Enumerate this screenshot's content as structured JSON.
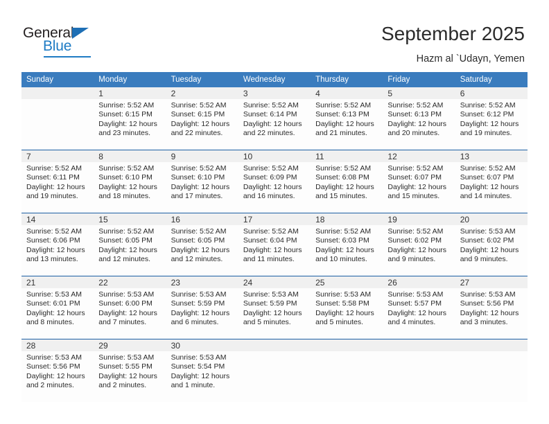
{
  "brand": {
    "name_general": "General",
    "name_blue": "Blue"
  },
  "header": {
    "title": "September 2025",
    "subtitle": "Hazm al `Udayn, Yemen"
  },
  "colors": {
    "header_blue": "#3a7cbe",
    "row_rule_blue": "#1b5fa4",
    "daynum_band": "#f0f0f0",
    "logo_blue": "#1e7bc4"
  },
  "calendar": {
    "weekdays": [
      "Sunday",
      "Monday",
      "Tuesday",
      "Wednesday",
      "Thursday",
      "Friday",
      "Saturday"
    ],
    "weeks": [
      [
        {
          "day": "",
          "empty": true
        },
        {
          "day": "1",
          "sunrise": "Sunrise: 5:52 AM",
          "sunset": "Sunset: 6:15 PM",
          "daylight": "Daylight: 12 hours and 23 minutes."
        },
        {
          "day": "2",
          "sunrise": "Sunrise: 5:52 AM",
          "sunset": "Sunset: 6:15 PM",
          "daylight": "Daylight: 12 hours and 22 minutes."
        },
        {
          "day": "3",
          "sunrise": "Sunrise: 5:52 AM",
          "sunset": "Sunset: 6:14 PM",
          "daylight": "Daylight: 12 hours and 22 minutes."
        },
        {
          "day": "4",
          "sunrise": "Sunrise: 5:52 AM",
          "sunset": "Sunset: 6:13 PM",
          "daylight": "Daylight: 12 hours and 21 minutes."
        },
        {
          "day": "5",
          "sunrise": "Sunrise: 5:52 AM",
          "sunset": "Sunset: 6:13 PM",
          "daylight": "Daylight: 12 hours and 20 minutes."
        },
        {
          "day": "6",
          "sunrise": "Sunrise: 5:52 AM",
          "sunset": "Sunset: 6:12 PM",
          "daylight": "Daylight: 12 hours and 19 minutes."
        }
      ],
      [
        {
          "day": "7",
          "sunrise": "Sunrise: 5:52 AM",
          "sunset": "Sunset: 6:11 PM",
          "daylight": "Daylight: 12 hours and 19 minutes."
        },
        {
          "day": "8",
          "sunrise": "Sunrise: 5:52 AM",
          "sunset": "Sunset: 6:10 PM",
          "daylight": "Daylight: 12 hours and 18 minutes."
        },
        {
          "day": "9",
          "sunrise": "Sunrise: 5:52 AM",
          "sunset": "Sunset: 6:10 PM",
          "daylight": "Daylight: 12 hours and 17 minutes."
        },
        {
          "day": "10",
          "sunrise": "Sunrise: 5:52 AM",
          "sunset": "Sunset: 6:09 PM",
          "daylight": "Daylight: 12 hours and 16 minutes."
        },
        {
          "day": "11",
          "sunrise": "Sunrise: 5:52 AM",
          "sunset": "Sunset: 6:08 PM",
          "daylight": "Daylight: 12 hours and 15 minutes."
        },
        {
          "day": "12",
          "sunrise": "Sunrise: 5:52 AM",
          "sunset": "Sunset: 6:07 PM",
          "daylight": "Daylight: 12 hours and 15 minutes."
        },
        {
          "day": "13",
          "sunrise": "Sunrise: 5:52 AM",
          "sunset": "Sunset: 6:07 PM",
          "daylight": "Daylight: 12 hours and 14 minutes."
        }
      ],
      [
        {
          "day": "14",
          "sunrise": "Sunrise: 5:52 AM",
          "sunset": "Sunset: 6:06 PM",
          "daylight": "Daylight: 12 hours and 13 minutes."
        },
        {
          "day": "15",
          "sunrise": "Sunrise: 5:52 AM",
          "sunset": "Sunset: 6:05 PM",
          "daylight": "Daylight: 12 hours and 12 minutes."
        },
        {
          "day": "16",
          "sunrise": "Sunrise: 5:52 AM",
          "sunset": "Sunset: 6:05 PM",
          "daylight": "Daylight: 12 hours and 12 minutes."
        },
        {
          "day": "17",
          "sunrise": "Sunrise: 5:52 AM",
          "sunset": "Sunset: 6:04 PM",
          "daylight": "Daylight: 12 hours and 11 minutes."
        },
        {
          "day": "18",
          "sunrise": "Sunrise: 5:52 AM",
          "sunset": "Sunset: 6:03 PM",
          "daylight": "Daylight: 12 hours and 10 minutes."
        },
        {
          "day": "19",
          "sunrise": "Sunrise: 5:52 AM",
          "sunset": "Sunset: 6:02 PM",
          "daylight": "Daylight: 12 hours and 9 minutes."
        },
        {
          "day": "20",
          "sunrise": "Sunrise: 5:53 AM",
          "sunset": "Sunset: 6:02 PM",
          "daylight": "Daylight: 12 hours and 9 minutes."
        }
      ],
      [
        {
          "day": "21",
          "sunrise": "Sunrise: 5:53 AM",
          "sunset": "Sunset: 6:01 PM",
          "daylight": "Daylight: 12 hours and 8 minutes."
        },
        {
          "day": "22",
          "sunrise": "Sunrise: 5:53 AM",
          "sunset": "Sunset: 6:00 PM",
          "daylight": "Daylight: 12 hours and 7 minutes."
        },
        {
          "day": "23",
          "sunrise": "Sunrise: 5:53 AM",
          "sunset": "Sunset: 5:59 PM",
          "daylight": "Daylight: 12 hours and 6 minutes."
        },
        {
          "day": "24",
          "sunrise": "Sunrise: 5:53 AM",
          "sunset": "Sunset: 5:59 PM",
          "daylight": "Daylight: 12 hours and 5 minutes."
        },
        {
          "day": "25",
          "sunrise": "Sunrise: 5:53 AM",
          "sunset": "Sunset: 5:58 PM",
          "daylight": "Daylight: 12 hours and 5 minutes."
        },
        {
          "day": "26",
          "sunrise": "Sunrise: 5:53 AM",
          "sunset": "Sunset: 5:57 PM",
          "daylight": "Daylight: 12 hours and 4 minutes."
        },
        {
          "day": "27",
          "sunrise": "Sunrise: 5:53 AM",
          "sunset": "Sunset: 5:56 PM",
          "daylight": "Daylight: 12 hours and 3 minutes."
        }
      ],
      [
        {
          "day": "28",
          "sunrise": "Sunrise: 5:53 AM",
          "sunset": "Sunset: 5:56 PM",
          "daylight": "Daylight: 12 hours and 2 minutes."
        },
        {
          "day": "29",
          "sunrise": "Sunrise: 5:53 AM",
          "sunset": "Sunset: 5:55 PM",
          "daylight": "Daylight: 12 hours and 2 minutes."
        },
        {
          "day": "30",
          "sunrise": "Sunrise: 5:53 AM",
          "sunset": "Sunset: 5:54 PM",
          "daylight": "Daylight: 12 hours and 1 minute."
        },
        {
          "day": "",
          "empty": true
        },
        {
          "day": "",
          "empty": true
        },
        {
          "day": "",
          "empty": true
        },
        {
          "day": "",
          "empty": true
        }
      ]
    ]
  }
}
